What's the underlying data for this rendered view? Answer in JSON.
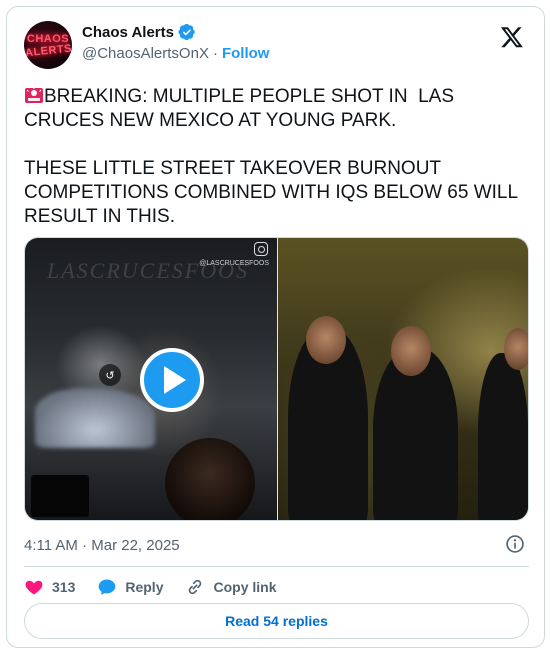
{
  "author": {
    "avatar_text_line1": "CHAOS",
    "avatar_text_line2": "ALERTS",
    "display_name": "Chaos Alerts",
    "verified": true,
    "handle": "@ChaosAlertsOnX",
    "separator": "·",
    "follow_label": "Follow"
  },
  "platform_icon": "x-logo-icon",
  "tweet": {
    "emoji": "siren-icon",
    "text_line1": "BREAKING: MULTIPLE PEOPLE SHOT IN  LAS CRUCES NEW MEXICO AT YOUNG PARK.",
    "text_line2": "THESE LITTLE STREET TAKEOVER BURNOUT COMPETITIONS COMBINED WITH IQS BELOW 65 WILL RESULT IN THIS."
  },
  "media": {
    "watermark": "LASCRUCESFOOS",
    "ig_handle": "@LASCRUCESFOOS",
    "play_icon": "play-icon",
    "seek_back_label": "↺",
    "seek_forward_label": "↻"
  },
  "meta": {
    "timestamp": "4:11 AM · Mar 22, 2025"
  },
  "actions": {
    "like_count": "313",
    "reply_label": "Reply",
    "copy_link_label": "Copy link"
  },
  "read_replies_label": "Read 54 replies",
  "colors": {
    "accent": "#1d9bf0",
    "like": "#f91880",
    "link": "#006fd6",
    "muted": "#536471",
    "border": "#cfd9de"
  }
}
